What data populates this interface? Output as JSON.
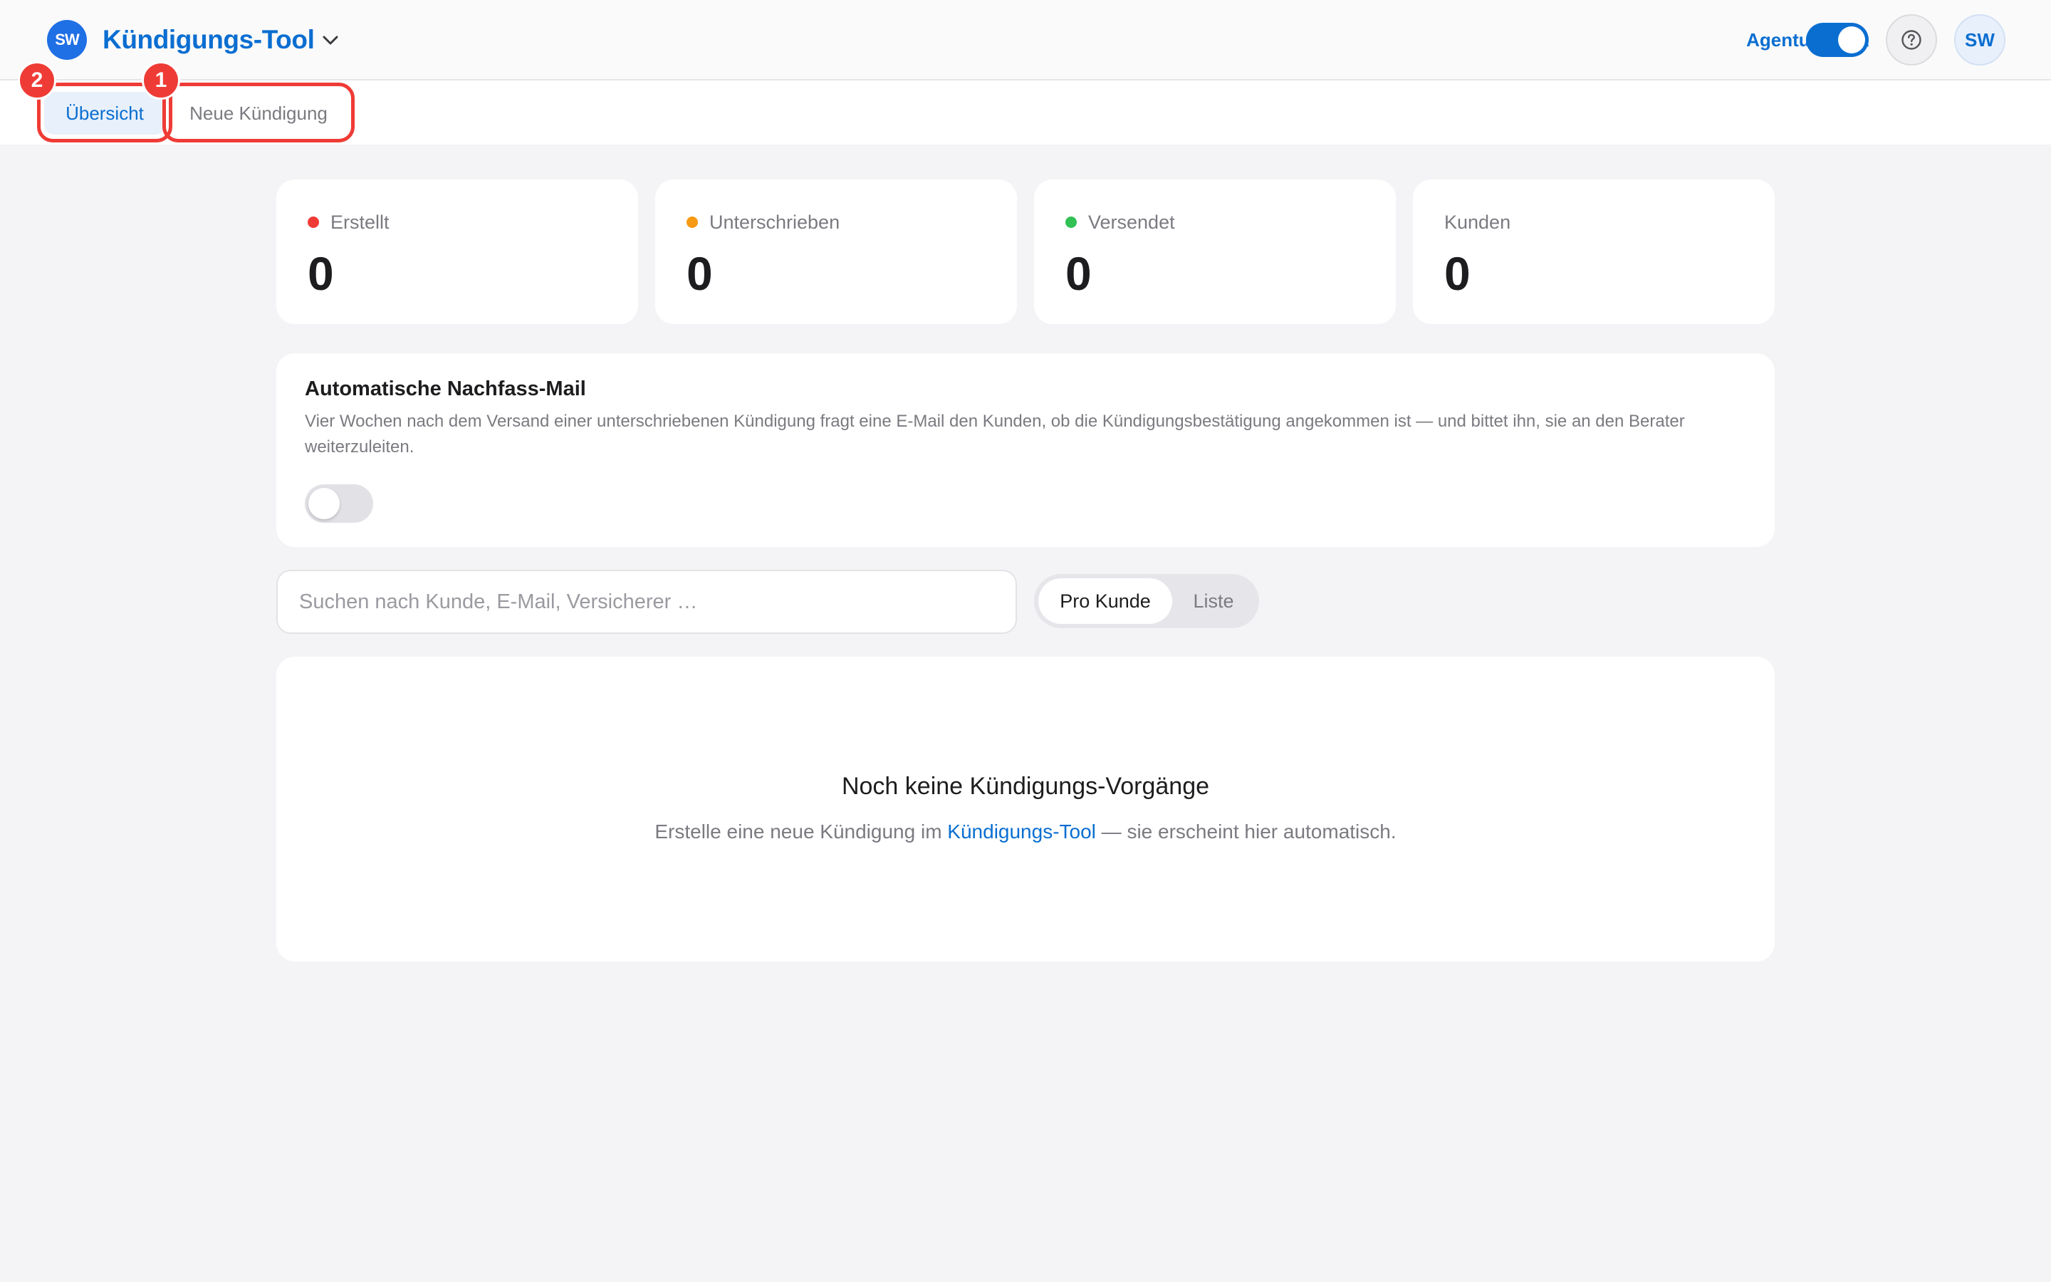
{
  "header": {
    "logo_initials": "SW",
    "app_title": "Kündigungs-Tool",
    "agency_view_label": "Agentur-Sicht",
    "agency_view_enabled": true,
    "avatar_initials": "SW"
  },
  "tabs": [
    {
      "label": "Übersicht",
      "active": true
    },
    {
      "label": "Neue Kündigung",
      "active": false
    }
  ],
  "annotations": [
    {
      "number": "1"
    },
    {
      "number": "2"
    }
  ],
  "stats": [
    {
      "label": "Erstellt",
      "value": "0",
      "dot_color": "#ef3b35"
    },
    {
      "label": "Unterschrieben",
      "value": "0",
      "dot_color": "#f59a12"
    },
    {
      "label": "Versendet",
      "value": "0",
      "dot_color": "#31c154"
    },
    {
      "label": "Kunden",
      "value": "0"
    }
  ],
  "followup": {
    "title": "Automatische Nachfass-Mail",
    "description": "Vier Wochen nach dem Versand einer unterschriebenen Kündigung fragt eine E-Mail den Kunden, ob die Kündigungsbestätigung angekommen ist — und bittet ihn, sie an den Berater weiterzuleiten.",
    "enabled": false
  },
  "search": {
    "placeholder": "Suchen nach Kunde, E-Mail, Versicherer …",
    "value": ""
  },
  "view_switch": {
    "options": [
      "Pro Kunde",
      "Liste"
    ],
    "selected": "Pro Kunde"
  },
  "empty_state": {
    "title": "Noch keine Kündigungs-Vorgänge",
    "text_before": "Erstelle eine neue Kündigung im ",
    "link": "Kündigungs-Tool",
    "text_after": " — sie erscheint hier automatisch."
  },
  "colors": {
    "accent": "#0a6ed1",
    "logo": "#1f6fe5",
    "highlight": "#ef3b35"
  }
}
